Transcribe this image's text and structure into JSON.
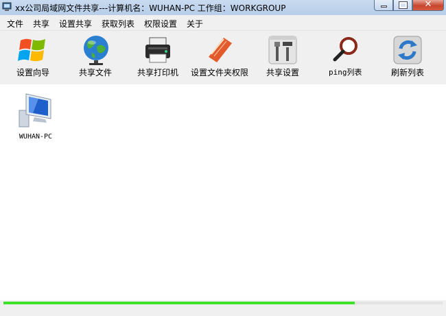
{
  "window": {
    "title": "xx公司局域网文件共享---计算机名：WUHAN-PC  工作组：WORKGROUP",
    "close_symbol": "✕"
  },
  "menu": [
    {
      "label": "文件"
    },
    {
      "label": "共享"
    },
    {
      "label": "设置共享"
    },
    {
      "label": "获取列表"
    },
    {
      "label": "权限设置"
    },
    {
      "label": "关于"
    }
  ],
  "toolbar": [
    {
      "label": "设置向导",
      "icon": "windows-logo-icon"
    },
    {
      "label": "共享文件",
      "icon": "globe-icon"
    },
    {
      "label": "共享打印机",
      "icon": "printer-icon"
    },
    {
      "label": "设置文件夹权限",
      "icon": "folder-book-icon"
    },
    {
      "label": "共享设置",
      "icon": "tools-icon"
    },
    {
      "label": "ping列表",
      "icon": "magnifier-icon"
    },
    {
      "label": "刷新列表",
      "icon": "refresh-icon"
    }
  ],
  "computers": [
    {
      "name": "WUHAN-PC",
      "icon": "computer-icon"
    }
  ],
  "status": {
    "progress": 0.8
  },
  "colors": {
    "progress_green": "#3ee22a",
    "titlebar": "#c3d6ee",
    "close_red": "#c7452e"
  }
}
